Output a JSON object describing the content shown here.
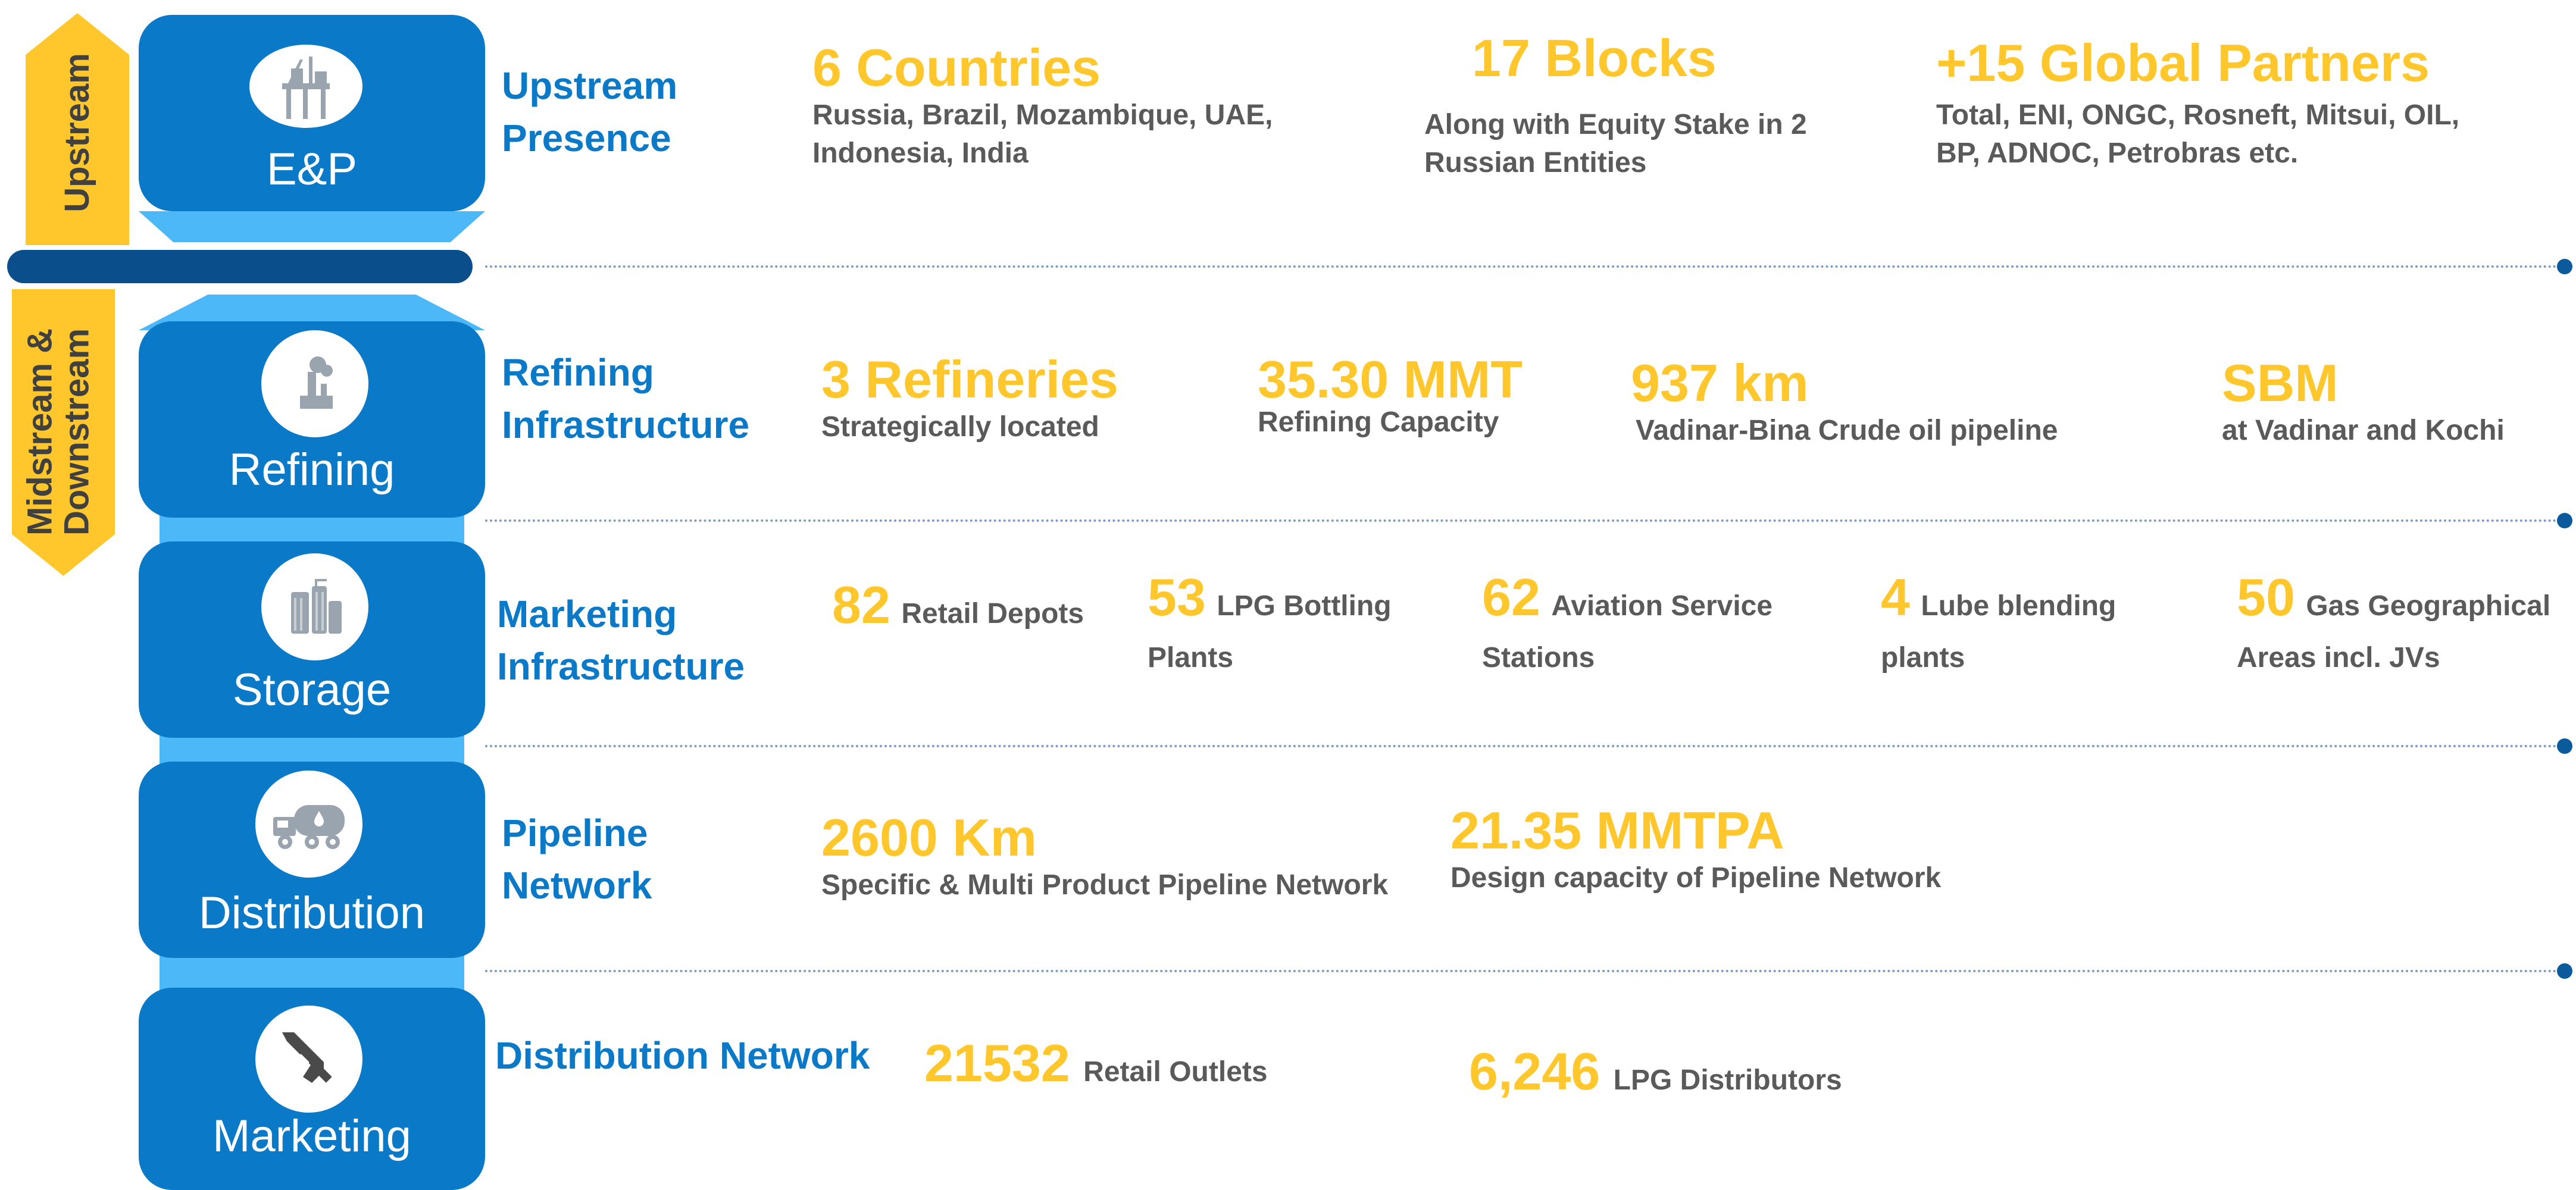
{
  "colors": {
    "accent_yellow": "#FFC72C",
    "card_blue": "#0A79C8",
    "connector_blue": "#4DB8F7",
    "heading_blue": "#0A79C8",
    "divider_navy": "#0A4F8C",
    "text_gray": "#5A5A5A"
  },
  "side_labels": {
    "upstream": "Upstream",
    "midstream_line1": "Midstream &",
    "midstream_line2": "Downstream"
  },
  "stages": [
    {
      "label": "E&P",
      "icon": "oil-rig-icon"
    },
    {
      "label": "Refining",
      "icon": "refinery-icon"
    },
    {
      "label": "Storage",
      "icon": "storage-tanks-icon"
    },
    {
      "label": "Distribution",
      "icon": "tanker-truck-icon"
    },
    {
      "label": "Marketing",
      "icon": "fuel-nozzle-icon"
    }
  ],
  "rows": {
    "upstream": {
      "heading_line1": "Upstream",
      "heading_line2": "Presence",
      "stats": [
        {
          "value": "6 Countries",
          "desc": "Russia, Brazil, Mozambique, UAE, Indonesia, India"
        },
        {
          "value": "17 Blocks",
          "desc": "Along with Equity Stake in 2 Russian Entities"
        },
        {
          "value": "+15 Global Partners",
          "desc": "Total, ENI, ONGC, Rosneft, Mitsui, OIL, BP, ADNOC, Petrobras etc."
        }
      ]
    },
    "refining": {
      "heading_line1": "Refining",
      "heading_line2": "Infrastructure",
      "stats": [
        {
          "value": "3 Refineries",
          "desc": "Strategically located"
        },
        {
          "value": "35.30 MMT",
          "desc": "Refining Capacity"
        },
        {
          "value": "937 km",
          "desc": "Vadinar-Bina Crude oil pipeline"
        },
        {
          "value": "SBM",
          "desc": "at Vadinar and Kochi"
        }
      ]
    },
    "marketing_infra": {
      "heading_line1": "Marketing",
      "heading_line2": "Infrastructure",
      "stats": [
        {
          "value": "82",
          "desc": "Retail Depots"
        },
        {
          "value": "53",
          "desc": "LPG Bottling Plants"
        },
        {
          "value": "62",
          "desc": "Aviation Service Stations"
        },
        {
          "value": "4",
          "desc": "Lube blending plants"
        },
        {
          "value": "50",
          "desc": "Gas Geographical Areas incl. JVs"
        }
      ]
    },
    "pipeline": {
      "heading_line1": "Pipeline",
      "heading_line2": "Network",
      "stats": [
        {
          "value": "2600 Km",
          "desc": "Specific & Multi Product Pipeline Network"
        },
        {
          "value": "21.35 MMTPA",
          "desc": "Design capacity of Pipeline Network"
        }
      ]
    },
    "distribution": {
      "heading": "Distribution Network",
      "stats": [
        {
          "value": "21532",
          "desc": "Retail Outlets"
        },
        {
          "value": "6,246",
          "desc": "LPG Distributors"
        }
      ]
    }
  }
}
